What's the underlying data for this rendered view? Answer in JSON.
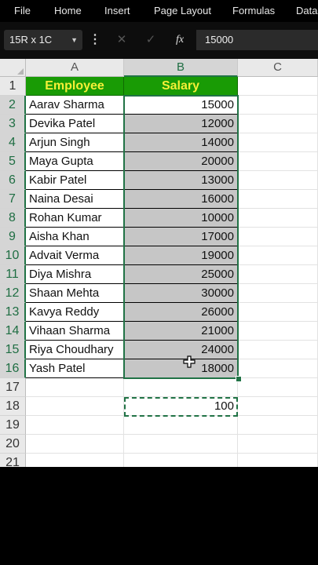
{
  "menu": [
    "File",
    "Home",
    "Insert",
    "Page Layout",
    "Formulas",
    "Data"
  ],
  "formula_bar": {
    "name_box": "15R x 1C",
    "formula": "15000",
    "fx_label": "fx"
  },
  "columns": [
    "A",
    "B",
    "C"
  ],
  "rows": [
    {
      "num": "1",
      "a": "Employee",
      "b": "Salary"
    },
    {
      "num": "2",
      "a": "Aarav Sharma",
      "b": "15000"
    },
    {
      "num": "3",
      "a": "Devika Patel",
      "b": "12000"
    },
    {
      "num": "4",
      "a": "Arjun Singh",
      "b": "14000"
    },
    {
      "num": "5",
      "a": "Maya Gupta",
      "b": "20000"
    },
    {
      "num": "6",
      "a": "Kabir Patel",
      "b": "13000"
    },
    {
      "num": "7",
      "a": "Naina Desai",
      "b": "16000"
    },
    {
      "num": "8",
      "a": "Rohan Kumar",
      "b": "10000"
    },
    {
      "num": "9",
      "a": "Aisha Khan",
      "b": "17000"
    },
    {
      "num": "10",
      "a": "Advait Verma",
      "b": "19000"
    },
    {
      "num": "11",
      "a": "Diya Mishra",
      "b": "25000"
    },
    {
      "num": "12",
      "a": "Shaan Mehta",
      "b": "30000"
    },
    {
      "num": "13",
      "a": "Kavya Reddy",
      "b": "26000"
    },
    {
      "num": "14",
      "a": "Vihaan Sharma",
      "b": "21000"
    },
    {
      "num": "15",
      "a": "Riya Choudhary",
      "b": "24000"
    },
    {
      "num": "16",
      "a": "Yash Patel",
      "b": "18000"
    },
    {
      "num": "17",
      "a": "",
      "b": ""
    },
    {
      "num": "18",
      "a": "",
      "b": "100"
    },
    {
      "num": "19",
      "a": "",
      "b": ""
    },
    {
      "num": "20",
      "a": "",
      "b": ""
    },
    {
      "num": "21",
      "a": "",
      "b": ""
    }
  ],
  "colors": {
    "header_fill": "#199b05",
    "header_text": "#f6ef37",
    "selection_fill": "#c6c6c6",
    "accent": "#217346"
  }
}
